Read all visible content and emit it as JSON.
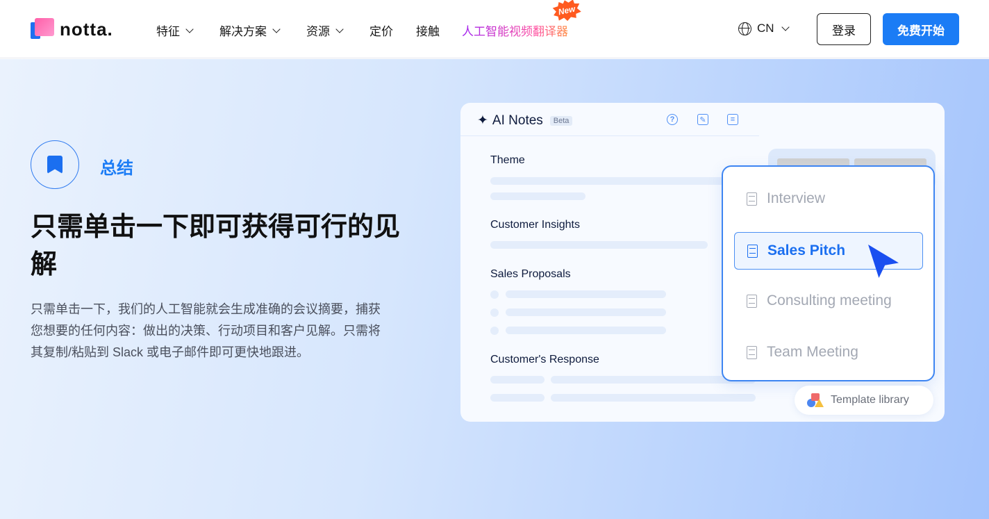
{
  "nav": {
    "brand": "notta.",
    "items": [
      {
        "label": "特征",
        "dropdown": true
      },
      {
        "label": "解决方案",
        "dropdown": true
      },
      {
        "label": "资源",
        "dropdown": true
      },
      {
        "label": "定价"
      },
      {
        "label": "接触"
      }
    ],
    "promo": {
      "label": "人工智能视频翻译器",
      "badge": "New"
    },
    "language": "CN",
    "login": "登录",
    "start": "免费开始"
  },
  "hero": {
    "tag": "总结",
    "title": "只需单击一下即可获得可行的见解",
    "description": "只需单击一下，我们的人工智能就会生成准确的会议摘要，捕获您想要的任何内容：做出的决策、行动项目和客户见解。只需将其复制/粘贴到 Slack 或电子邮件即可更快地跟进。"
  },
  "card": {
    "title": "AI Notes",
    "badge": "Beta",
    "header_icons": [
      "help-icon",
      "chat-edit-icon",
      "copy-notes-icon"
    ],
    "sections": [
      "Theme",
      "Customer Insights",
      "Sales Proposals",
      "Customer's Response"
    ],
    "templates": [
      {
        "label": "Interview",
        "selected": false
      },
      {
        "label": "Sales Pitch",
        "selected": true
      },
      {
        "label": "Consulting meeting",
        "selected": false
      },
      {
        "label": "Team Meeting",
        "selected": false
      }
    ],
    "template_library": "Template library"
  },
  "colors": {
    "accent": "#1b7cf5",
    "promo_start": "#a020f0",
    "promo_end": "#ff8a3d",
    "badge": "#ff5a1f"
  }
}
